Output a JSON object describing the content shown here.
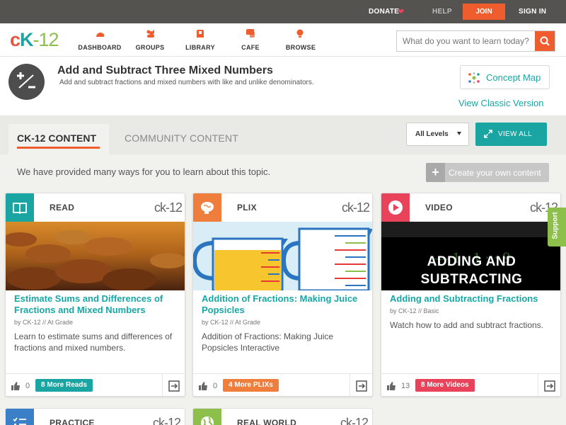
{
  "topbar": {
    "donate": "DONATE",
    "help": "HELP",
    "join": "JOIN",
    "signin": "SIGN IN"
  },
  "logo": {
    "c": "c",
    "k": "K",
    "rest": "-12"
  },
  "nav": [
    {
      "label": "DASHBOARD",
      "icon": "dashboard-icon"
    },
    {
      "label": "GROUPS",
      "icon": "groups-icon"
    },
    {
      "label": "LIBRARY",
      "icon": "library-icon"
    },
    {
      "label": "CAFE",
      "icon": "cafe-icon"
    },
    {
      "label": "BROWSE",
      "icon": "browse-icon"
    }
  ],
  "search": {
    "placeholder": "What do you want to learn today?"
  },
  "header": {
    "title": "Add and Subtract Three Mixed Numbers",
    "subtitle": "Add and subtract fractions and mixed numbers with like and unlike denominators.",
    "concept_map": "Concept Map",
    "classic": "View Classic Version"
  },
  "tabs": {
    "active": "CK-12 CONTENT",
    "other": "COMMUNITY CONTENT",
    "levels": "All Levels",
    "view_all": "VIEW ALL"
  },
  "intro": "We have provided many ways for you to learn about this topic.",
  "create": "Create your own content",
  "cards": [
    {
      "type": "READ",
      "logo": "ck-12",
      "accent": "#1aa5a2",
      "title": "Estimate Sums and Differences of Fractions and Mixed Numbers",
      "by": "by CK-12",
      "level": "At Grade",
      "desc": "Learn to estimate sums and differences of fractions and mixed numbers.",
      "likes": "0",
      "more": "8 More Reads",
      "more_color": "#1aa5a2"
    },
    {
      "type": "PLIX",
      "logo": "ck-12",
      "accent": "#ef7d3c",
      "title": "Addition of Fractions: Making Juice Popsicles",
      "by": "by CK-12",
      "level": "At Grade",
      "desc": "Addition of Fractions: Making Juice Popsicles Interactive",
      "likes": "0",
      "more": "4 More PLIXs",
      "more_color": "#ef7d3c"
    },
    {
      "type": "VIDEO",
      "logo": "ck-12",
      "accent": "#e9435b",
      "title": "Adding and Subtracting Fractions",
      "by": "by CK-12",
      "level": "Basic",
      "desc": "Watch how to add and subtract fractions.",
      "likes": "13",
      "more": "8 More Videos",
      "more_color": "#e9435b",
      "video_text_1": "ADDING AND",
      "video_text_2": "SUBTRACTING"
    }
  ],
  "bottom_cards": [
    {
      "type": "PRACTICE",
      "logo": "ck-12",
      "accent": "#3a80c9"
    },
    {
      "type": "REAL WORLD",
      "logo": "ck-12",
      "accent": "#8dc04a"
    }
  ],
  "support": "Support",
  "colors": {
    "brand_orange": "#ef5d2f",
    "teal": "#1aa5a2",
    "dark_bar": "#555350"
  }
}
